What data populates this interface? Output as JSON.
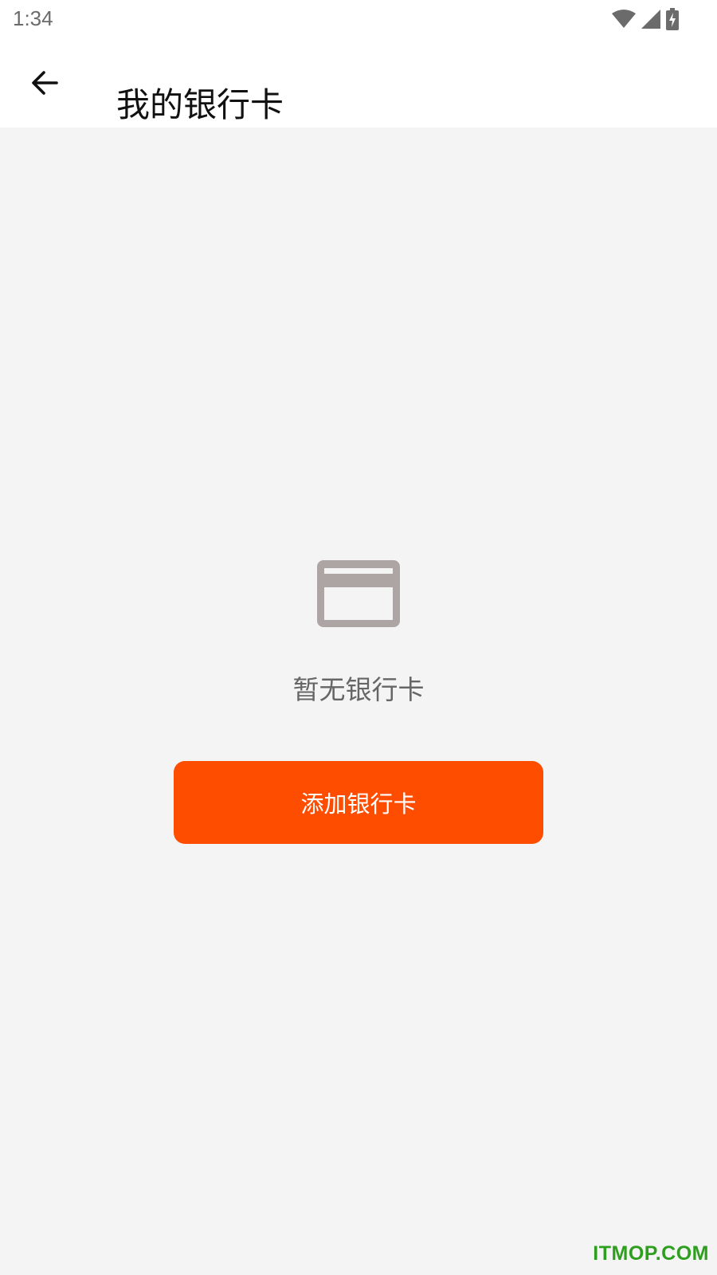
{
  "status_bar": {
    "time": "1:34",
    "icons": [
      "wifi-icon",
      "signal-icon",
      "battery-charging-icon"
    ]
  },
  "header": {
    "back_icon": "arrow-left-icon",
    "title": "我的银行卡"
  },
  "empty_state": {
    "icon": "credit-card-icon",
    "message": "暂无银行卡"
  },
  "actions": {
    "add_card_label": "添加银行卡"
  },
  "watermark": "ITMOP.COM",
  "colors": {
    "accent": "#ff4d00",
    "icon_gray": "#ada5a3",
    "background": "#f4f4f4",
    "watermark": "#2e9e1f"
  }
}
